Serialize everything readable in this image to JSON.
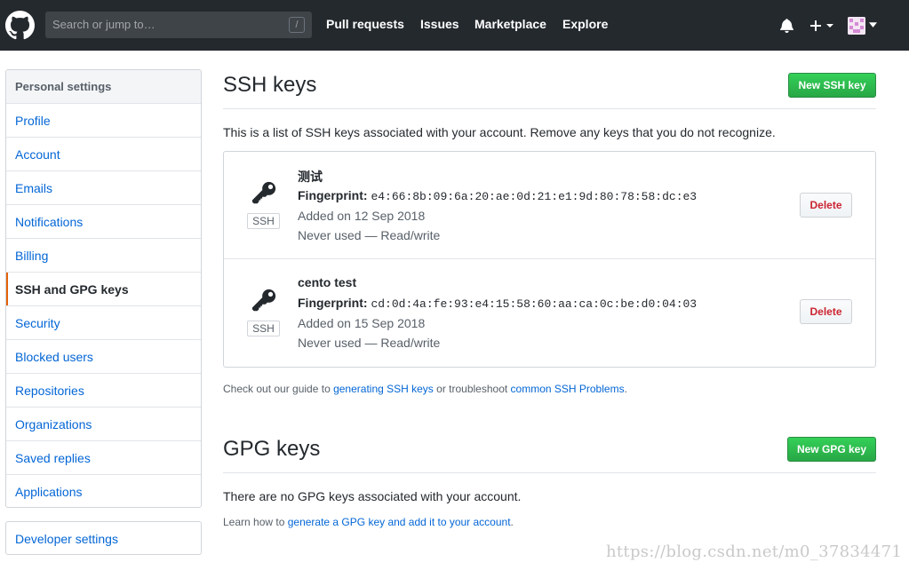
{
  "header": {
    "search_placeholder": "Search or jump to…",
    "search_shortcut": "/",
    "nav": [
      "Pull requests",
      "Issues",
      "Marketplace",
      "Explore"
    ],
    "icons": [
      "github-logo",
      "bell-icon",
      "plus-icon",
      "avatar"
    ]
  },
  "sidebar": {
    "heading": "Personal settings",
    "items": [
      "Profile",
      "Account",
      "Emails",
      "Notifications",
      "Billing",
      "SSH and GPG keys",
      "Security",
      "Blocked users",
      "Repositories",
      "Organizations",
      "Saved replies",
      "Applications"
    ],
    "selected": "SSH and GPG keys",
    "developer": "Developer settings"
  },
  "ssh": {
    "title": "SSH keys",
    "new_button": "New SSH key",
    "description": "This is a list of SSH keys associated with your account. Remove any keys that you do not recognize.",
    "keys": [
      {
        "title": "测试",
        "fingerprint_label": "Fingerprint:",
        "fingerprint": "e4:66:8b:09:6a:20:ae:0d:21:e1:9d:80:78:58:dc:e3",
        "added": "Added on 12 Sep 2018",
        "usage": "Never used — Read/write",
        "badge": "SSH",
        "delete": "Delete"
      },
      {
        "title": "cento test",
        "fingerprint_label": "Fingerprint:",
        "fingerprint": "cd:0d:4a:fe:93:e4:15:58:60:aa:ca:0c:be:d0:04:03",
        "added": "Added on 15 Sep 2018",
        "usage": "Never used — Read/write",
        "badge": "SSH",
        "delete": "Delete"
      }
    ],
    "guide_prefix": "Check out our guide to ",
    "guide_link1": "generating SSH keys",
    "guide_mid": " or troubleshoot ",
    "guide_link2": "common SSH Problems",
    "guide_suffix": "."
  },
  "gpg": {
    "title": "GPG keys",
    "new_button": "New GPG key",
    "empty": "There are no GPG keys associated with your account.",
    "learn_prefix": "Learn how to ",
    "learn_link": "generate a GPG key and add it to your account",
    "learn_suffix": "."
  },
  "watermark": "https://blog.csdn.net/m0_37834471",
  "colors": {
    "header_bg": "#24292e",
    "link": "#0366d6",
    "green": "#28a745",
    "danger": "#cb2431",
    "selected_bar": "#e36209"
  }
}
